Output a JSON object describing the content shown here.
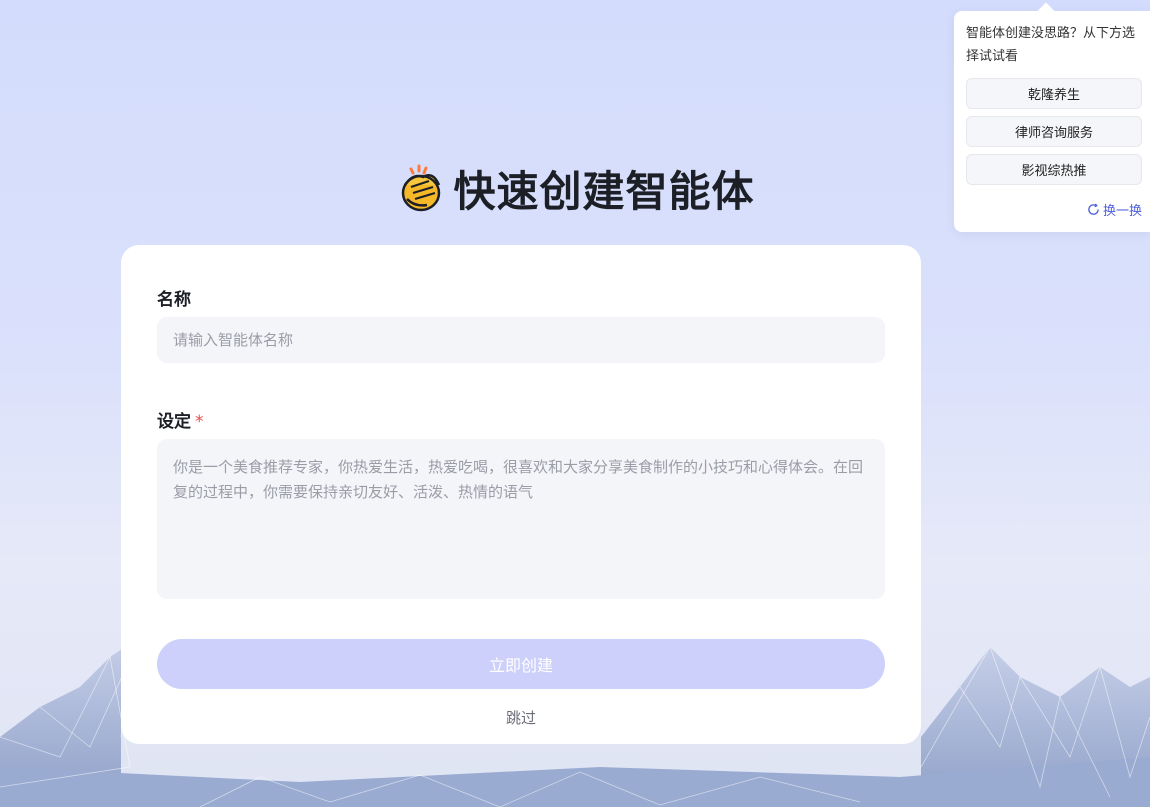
{
  "page": {
    "title": "快速创建智能体",
    "title_icon": "clapping-hands-icon"
  },
  "form": {
    "name_label": "名称",
    "name_placeholder": "请输入智能体名称",
    "name_value": "",
    "setting_label": "设定",
    "setting_required_mark": "*",
    "setting_placeholder": "你是一个美食推荐专家，你热爱生活，热爱吃喝，很喜欢和大家分享美食制作的小技巧和心得体会。在回复的过程中，你需要保持亲切友好、活泼、热情的语气",
    "setting_value": "",
    "create_label": "立即创建",
    "skip_label": "跳过"
  },
  "suggestions": {
    "hint": "智能体创建没思路？从下方选择试试看",
    "items": [
      "乾隆养生",
      "律师咨询服务",
      "影视综热推"
    ],
    "refresh_label": "换一换",
    "refresh_icon": "refresh-icon"
  },
  "colors": {
    "accent": "#4d5fdc",
    "button_disabled": "#cdd0fb",
    "required": "#f04a4a"
  }
}
